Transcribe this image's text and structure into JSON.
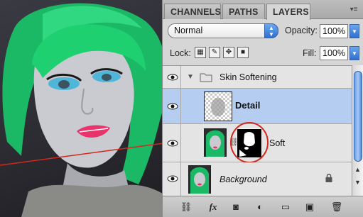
{
  "tabs": {
    "channels": "CHANNELS",
    "paths": "PATHS",
    "layers": "LAYERS"
  },
  "panel_menu_icon": "panel-menu-icon",
  "blend": {
    "mode": "Normal",
    "opacity_label": "Opacity:",
    "opacity_value": "100%"
  },
  "lock": {
    "label": "Lock:",
    "fill_label": "Fill:",
    "fill_value": "100%"
  },
  "layers": [
    {
      "name": "Skin Softening",
      "type": "group",
      "expanded": true
    },
    {
      "name": "Detail",
      "type": "layer",
      "selected": true
    },
    {
      "name": "Soft",
      "type": "layer",
      "has_mask": true
    },
    {
      "name": "Background",
      "type": "layer",
      "locked": true
    }
  ],
  "toolbar_icons": [
    "link-layers-icon",
    "fx-icon",
    "add-mask-icon",
    "adjustment-layer-icon",
    "new-group-icon",
    "new-layer-icon",
    "trash-icon"
  ],
  "toolbar_fx_label": "fx",
  "colors": {
    "selection": "#b4cdf0",
    "accent_blue": "#2f6fd1",
    "annotation_red": "#d2281e",
    "hair_green": "#18c266"
  }
}
